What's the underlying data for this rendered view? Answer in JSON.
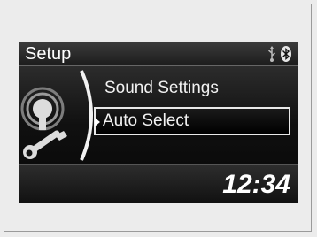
{
  "screen": {
    "title": "Setup",
    "status_icons": [
      "usb-icon",
      "bluetooth-icon"
    ],
    "menu": {
      "items": [
        {
          "label": "Sound Settings",
          "selected": false
        },
        {
          "label": "Auto Select",
          "selected": true
        }
      ]
    },
    "clock": "12:34"
  },
  "colors": {
    "screen_bg": "#000000",
    "text": "#ffffff",
    "emblem": "#d9d9d9",
    "highlight_border": "#e8e8e8"
  }
}
